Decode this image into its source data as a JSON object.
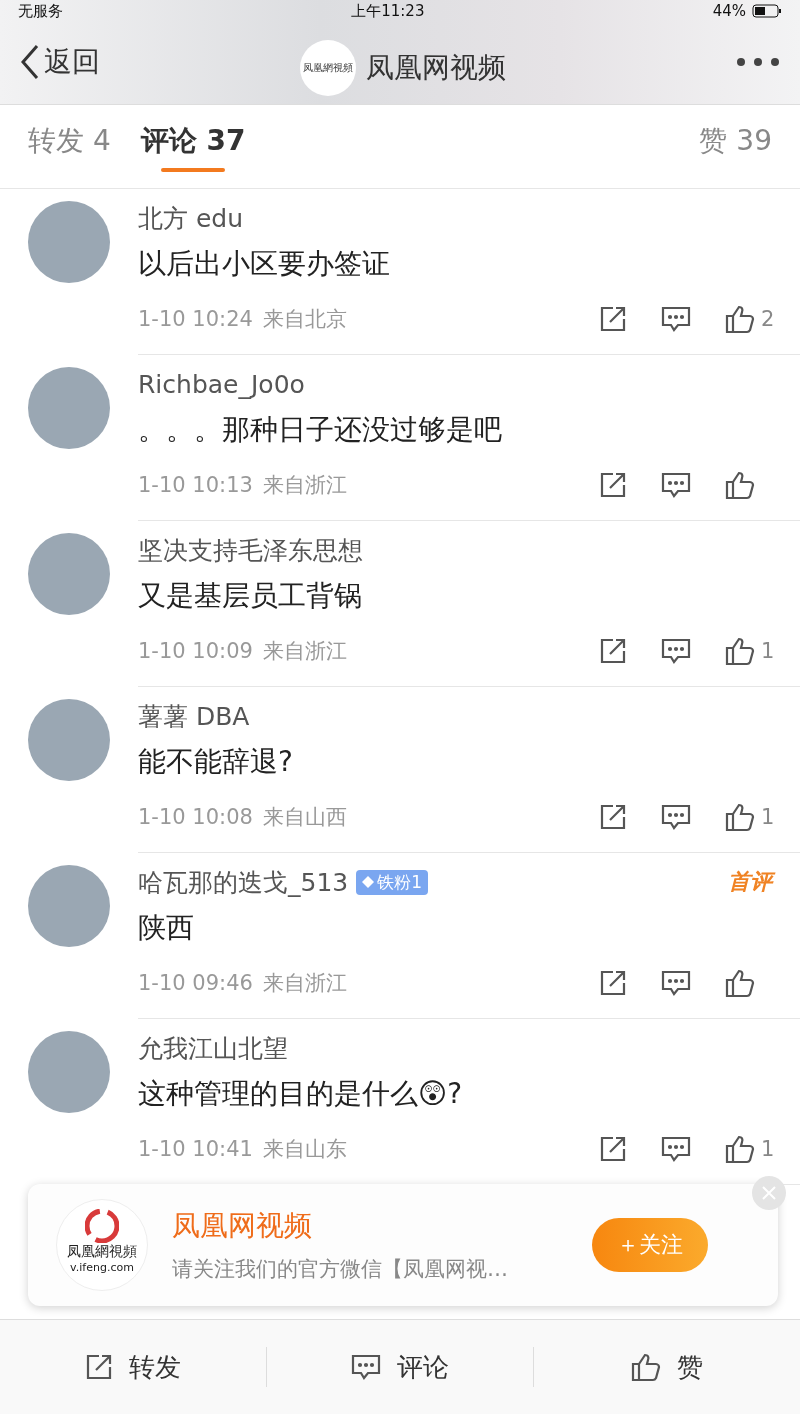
{
  "status_bar": {
    "carrier": "无服务",
    "time": "上午11:23",
    "battery": "44%"
  },
  "nav": {
    "back": "返回",
    "title": "凤凰网视频",
    "avatar_text": "凤凰網視頻"
  },
  "tabs": [
    {
      "label": "转发 4",
      "selected": false
    },
    {
      "label": "评论 37",
      "selected": true
    }
  ],
  "likes_tab": "赞 39",
  "comments": [
    {
      "name": "北方 edu",
      "text": "以后出小区要办签证",
      "time": "1-10 10:24",
      "location": "来自北京",
      "likes": "2"
    },
    {
      "name": "Richbae_Jo0o",
      "text": "。。。那种日子还没过够是吧",
      "time": "1-10 10:13",
      "location": "来自浙江"
    },
    {
      "name": "坚决支持毛泽东思想",
      "text": "又是基层员工背锅",
      "time": "1-10 10:09",
      "location": "来自浙江",
      "likes": "1"
    },
    {
      "name": "薯薯 DBA",
      "text": "能不能辞退?",
      "time": "1-10 10:08",
      "location": "来自山西",
      "likes": "1"
    },
    {
      "name": "哈瓦那的迭戈_513",
      "badge": "铁粉1",
      "tag": "首评",
      "text": "陕西",
      "time": "1-10 09:46",
      "location": "来自浙江"
    },
    {
      "name": "允我江山北望",
      "text": "这种管理的目的是什么😲?",
      "time": "1-10 10:41",
      "location": "来自山东",
      "likes": "1"
    }
  ],
  "banner": {
    "title": "凤凰网视频",
    "subtitle": "请关注我们的官方微信【凤凰网视…",
    "logo_text": "凤凰網視頻",
    "logo_url": "v.ifeng.com",
    "follow": "＋关注"
  },
  "bottom_bar": [
    {
      "label": "转发",
      "kind": "repost"
    },
    {
      "label": "评论",
      "kind": "comment"
    },
    {
      "label": "赞",
      "kind": "like"
    }
  ]
}
